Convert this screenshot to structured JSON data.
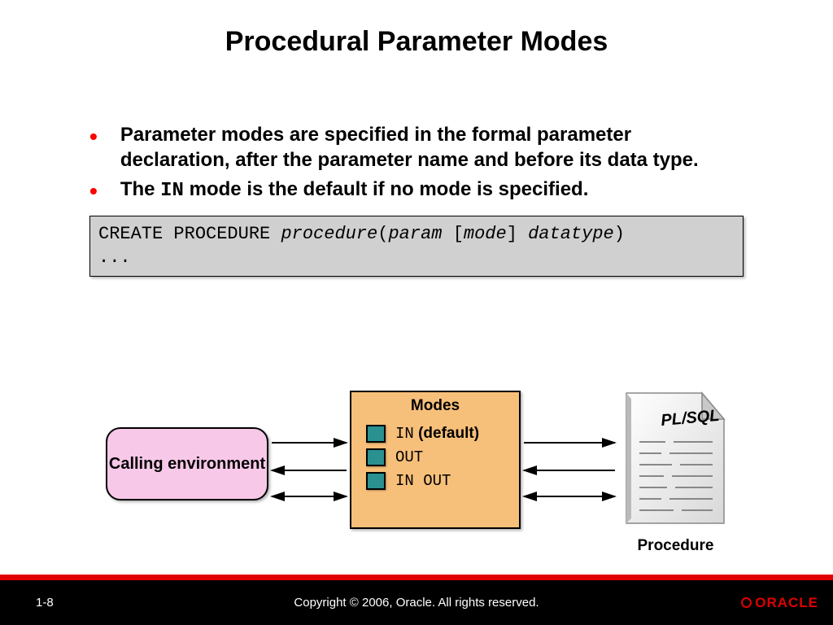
{
  "title": "Procedural Parameter Modes",
  "bullets": {
    "b1": "Parameter modes are specified in the formal parameter declaration, after the parameter name and before its data type.",
    "b2_pre": "The ",
    "b2_code": "IN",
    "b2_post": " mode is the default if no mode is specified."
  },
  "code": {
    "kw1": "CREATE PROCEDURE ",
    "v1": "procedure",
    "p1": "(",
    "v2": "param",
    "sp": " ",
    "lb": "[",
    "v3": "mode",
    "rb": "] ",
    "v4": "datatype",
    "p2": ")",
    "line2": "..."
  },
  "diagram": {
    "calling_label": "Calling environment",
    "modes_title": "Modes",
    "mode1_code": "IN",
    "mode1_note": " (default)",
    "mode2_code": "OUT",
    "mode3_code": "IN OUT",
    "plsql_label": "PL/SQL",
    "procedure_label": "Procedure"
  },
  "footer": {
    "page": "1-8",
    "copyright": "Copyright © 2006, Oracle.  All rights reserved.",
    "brand": "ORACLE"
  }
}
